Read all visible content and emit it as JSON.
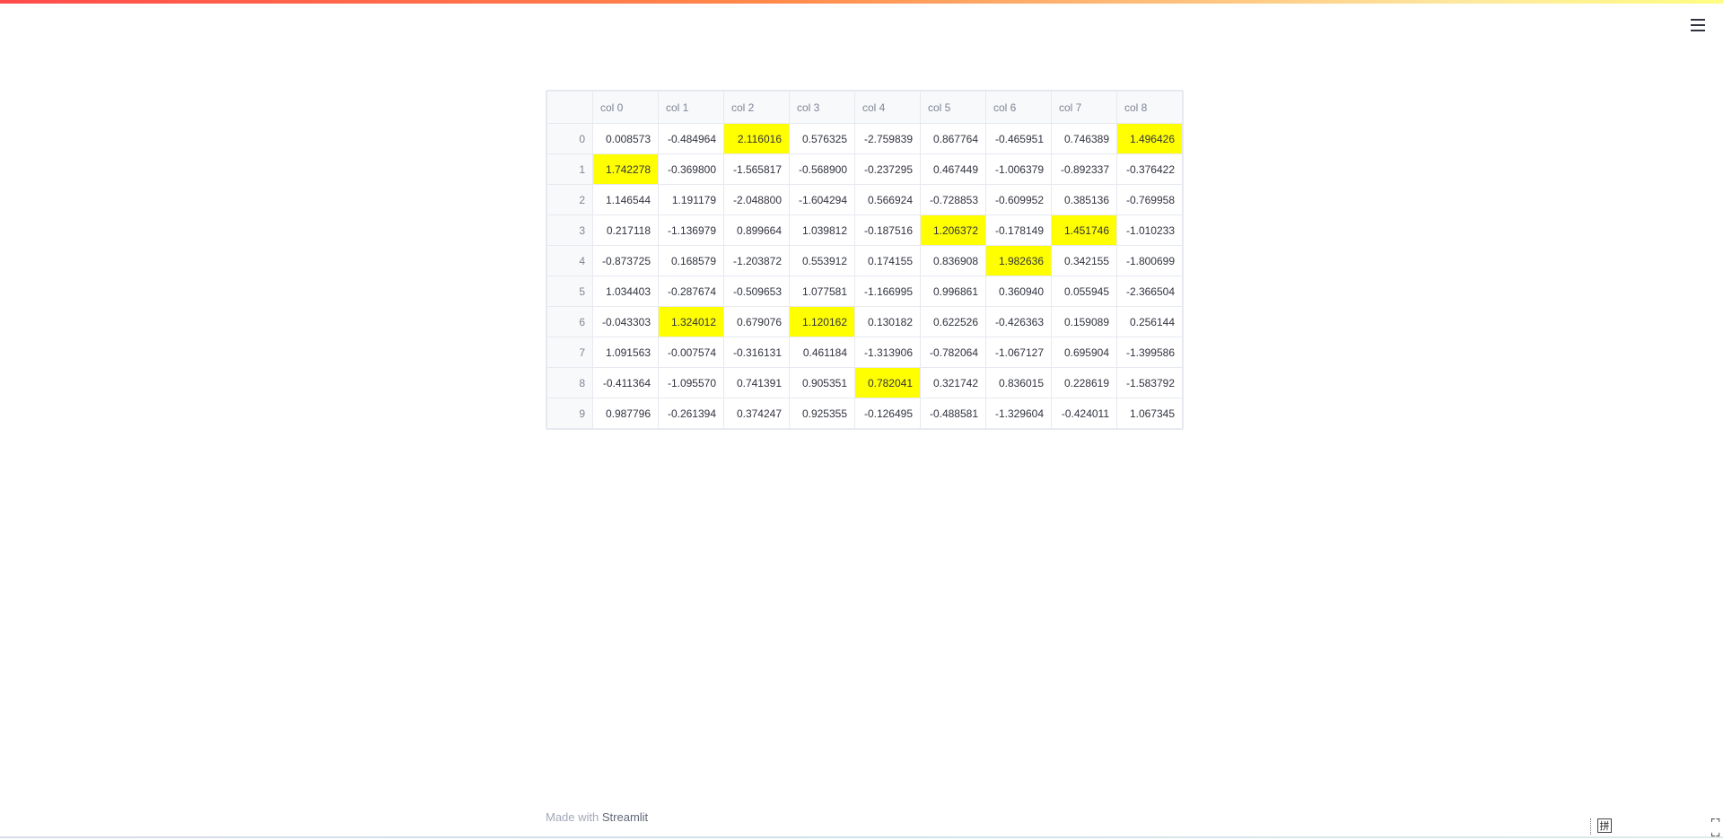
{
  "header": {
    "menu_icon": "hamburger-menu-icon",
    "accent_gradient": [
      "#ff4b4b",
      "#fffd80"
    ]
  },
  "table": {
    "columns": [
      "col 0",
      "col 1",
      "col 2",
      "col 3",
      "col 4",
      "col 5",
      "col 6",
      "col 7",
      "col 8"
    ],
    "highlight_color": "#ffff00",
    "rows": [
      {
        "index": "0",
        "cells": [
          "0.008573",
          "-0.484964",
          "2.116016",
          "0.576325",
          "-2.759839",
          "0.867764",
          "-0.465951",
          "0.746389",
          "1.496426"
        ],
        "highlight": [
          2,
          8
        ]
      },
      {
        "index": "1",
        "cells": [
          "1.742278",
          "-0.369800",
          "-1.565817",
          "-0.568900",
          "-0.237295",
          "0.467449",
          "-1.006379",
          "-0.892337",
          "-0.376422"
        ],
        "highlight": [
          0
        ]
      },
      {
        "index": "2",
        "cells": [
          "1.146544",
          "1.191179",
          "-2.048800",
          "-1.604294",
          "0.566924",
          "-0.728853",
          "-0.609952",
          "0.385136",
          "-0.769958"
        ],
        "highlight": []
      },
      {
        "index": "3",
        "cells": [
          "0.217118",
          "-1.136979",
          "0.899664",
          "1.039812",
          "-0.187516",
          "1.206372",
          "-0.178149",
          "1.451746",
          "-1.010233"
        ],
        "highlight": [
          5,
          7
        ]
      },
      {
        "index": "4",
        "cells": [
          "-0.873725",
          "0.168579",
          "-1.203872",
          "0.553912",
          "0.174155",
          "0.836908",
          "1.982636",
          "0.342155",
          "-1.800699"
        ],
        "highlight": [
          6
        ]
      },
      {
        "index": "5",
        "cells": [
          "1.034403",
          "-0.287674",
          "-0.509653",
          "1.077581",
          "-1.166995",
          "0.996861",
          "0.360940",
          "0.055945",
          "-2.366504"
        ],
        "highlight": []
      },
      {
        "index": "6",
        "cells": [
          "-0.043303",
          "1.324012",
          "0.679076",
          "1.120162",
          "0.130182",
          "0.622526",
          "-0.426363",
          "0.159089",
          "0.256144"
        ],
        "highlight": [
          1,
          3
        ]
      },
      {
        "index": "7",
        "cells": [
          "1.091563",
          "-0.007574",
          "-0.316131",
          "0.461184",
          "-1.313906",
          "-0.782064",
          "-1.067127",
          "0.695904",
          "-1.399586"
        ],
        "highlight": []
      },
      {
        "index": "8",
        "cells": [
          "-0.411364",
          "-1.095570",
          "0.741391",
          "0.905351",
          "0.782041",
          "0.321742",
          "0.836015",
          "0.228619",
          "-1.583792"
        ],
        "highlight": [
          4
        ]
      },
      {
        "index": "9",
        "cells": [
          "0.987796",
          "-0.261394",
          "0.374247",
          "0.925355",
          "-0.126495",
          "-0.488581",
          "-1.329604",
          "-0.424011",
          "1.067345"
        ],
        "highlight": []
      }
    ]
  },
  "footer": {
    "prefix": "Made with",
    "link": "Streamlit"
  },
  "system_tray": {
    "ime_label": "拼",
    "ime_icon": "pinyin-ime-icon",
    "expand_icon": "expand-icon"
  }
}
